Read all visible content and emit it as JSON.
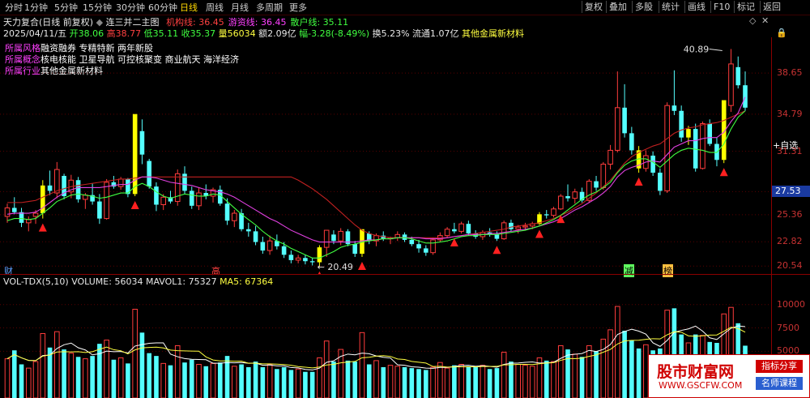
{
  "toolbar": {
    "periods": [
      "分时",
      "1分钟",
      "5分钟",
      "15分钟",
      "30分钟",
      "60分钟",
      "日线",
      "周线",
      "月线",
      "多周期",
      "更多"
    ],
    "active": "日线",
    "buttons": [
      "复权",
      "叠加",
      "多股",
      "统计",
      "画线",
      "F10",
      "标记",
      "返回"
    ],
    "right_side": [
      "+自选",
      "◆ 画"
    ]
  },
  "header": {
    "title": "天力复合(日线 前复权)",
    "indicator": "连三并二主图",
    "lines": [
      {
        "label": "机构线: 36.45",
        "color": "#ff4040"
      },
      {
        "label": "游资线: 36.45",
        "color": "#ff40ff"
      },
      {
        "label": "散户线: 35.11",
        "color": "#40ff40"
      }
    ],
    "date": "2025/04/11/五",
    "open": "开38.06",
    "high": "高38.77",
    "low": "低35.11",
    "close": "收35.37",
    "vol": "量56034",
    "amount": "额2.09亿",
    "change": "幅-3.28(-8.49%)",
    "turnover": "换5.23%",
    "float": "流通1.07亿",
    "sector": "其他金属新材料"
  },
  "tags": [
    {
      "label": "所属风格",
      "text": "融资融券 专精特新 两年新股"
    },
    {
      "label": "所属概念",
      "text": "核电核能 卫星导航 可控核聚变 商业航天 海洋经济"
    },
    {
      "label": "所属行业",
      "text": "其他金属新材料"
    }
  ],
  "price_axis": [
    "38.65",
    "34.79",
    "31.31",
    "27.53",
    "25.36",
    "22.82",
    "20.54"
  ],
  "current_price": "27.53",
  "annotations": {
    "high": "40.89",
    "low": "← 20.49",
    "markers": [
      "财",
      "高",
      "减",
      "榜"
    ]
  },
  "volume_header": {
    "name": "VOL-TDX(5,10)",
    "volume": "VOLUME: 56034",
    "mavol1": "MAVOL1: 75327",
    "ma5": "MA5: 67364"
  },
  "volume_axis": [
    "10000",
    "7500",
    "5000"
  ],
  "watermark": {
    "site": "股市财富网",
    "url": "WWW.GSCFW.COM",
    "b1": "指标分享",
    "b2": "名师课程"
  },
  "chart_data": {
    "type": "candlestick",
    "ylim": [
      19.8,
      42.0
    ],
    "candles": [
      [
        25.2,
        26.4,
        24.6,
        26.0
      ],
      [
        26.0,
        27.0,
        25.4,
        25.6
      ],
      [
        25.6,
        26.0,
        24.2,
        24.6
      ],
      [
        24.6,
        25.2,
        23.8,
        24.9
      ],
      [
        25.2,
        25.8,
        24.5,
        25.5
      ],
      [
        25.5,
        28.6,
        25.0,
        28.1
      ],
      [
        28.1,
        29.5,
        27.2,
        27.6
      ],
      [
        27.4,
        30.3,
        26.9,
        29.6
      ],
      [
        29.0,
        29.2,
        26.8,
        27.1
      ],
      [
        27.5,
        29.1,
        26.9,
        28.6
      ],
      [
        28.6,
        28.9,
        26.5,
        26.8
      ],
      [
        26.8,
        27.4,
        25.9,
        27.2
      ],
      [
        27.2,
        28.3,
        26.3,
        26.6
      ],
      [
        26.6,
        27.3,
        24.5,
        25.0
      ],
      [
        25.0,
        28.7,
        24.9,
        28.4
      ],
      [
        28.4,
        29.0,
        27.8,
        28.0
      ],
      [
        28.0,
        28.9,
        27.7,
        28.7
      ],
      [
        28.7,
        28.8,
        27.0,
        27.3
      ],
      [
        27.3,
        31.5,
        27.1,
        34.8
      ],
      [
        33.2,
        34.3,
        30.1,
        31.0
      ],
      [
        30.4,
        30.6,
        27.8,
        28.0
      ],
      [
        28.0,
        28.4,
        25.7,
        26.3
      ],
      [
        26.3,
        27.3,
        25.8,
        27.0
      ],
      [
        27.0,
        27.6,
        26.4,
        26.6
      ],
      [
        26.6,
        29.6,
        26.2,
        29.2
      ],
      [
        29.2,
        29.9,
        27.3,
        27.6
      ],
      [
        27.6,
        28.0,
        25.9,
        26.2
      ],
      [
        26.2,
        27.9,
        25.8,
        27.4
      ],
      [
        27.4,
        28.2,
        26.8,
        27.1
      ],
      [
        27.1,
        27.9,
        26.5,
        27.7
      ],
      [
        27.7,
        28.1,
        26.2,
        26.4
      ],
      [
        26.4,
        26.9,
        24.4,
        24.8
      ],
      [
        24.8,
        25.8,
        24.2,
        25.5
      ],
      [
        25.5,
        25.9,
        23.8,
        24.0
      ],
      [
        24.0,
        24.6,
        23.3,
        23.8
      ],
      [
        23.8,
        24.3,
        22.5,
        22.8
      ],
      [
        22.8,
        23.3,
        21.7,
        22.0
      ],
      [
        22.0,
        23.4,
        21.6,
        22.9
      ],
      [
        22.9,
        23.5,
        22.1,
        22.4
      ],
      [
        22.4,
        22.8,
        21.3,
        21.6
      ],
      [
        21.6,
        22.0,
        20.8,
        21.1
      ],
      [
        21.1,
        21.6,
        20.8,
        21.3
      ],
      [
        21.3,
        21.6,
        20.7,
        21.0
      ],
      [
        21.0,
        21.3,
        20.6,
        20.9
      ],
      [
        20.9,
        22.5,
        20.5,
        22.3
      ],
      [
        22.3,
        23.2,
        21.4,
        23.9
      ],
      [
        23.5,
        23.9,
        22.6,
        22.9
      ],
      [
        22.9,
        24.1,
        22.5,
        23.8
      ],
      [
        23.8,
        24.0,
        22.4,
        22.6
      ],
      [
        22.6,
        22.9,
        21.4,
        21.7
      ],
      [
        21.7,
        23.6,
        21.4,
        24.0
      ],
      [
        23.6,
        23.8,
        22.6,
        22.9
      ],
      [
        22.9,
        23.6,
        22.4,
        23.4
      ],
      [
        23.4,
        23.8,
        22.9,
        23.1
      ],
      [
        23.1,
        23.3,
        22.6,
        23.2
      ],
      [
        23.2,
        23.8,
        22.9,
        23.5
      ],
      [
        23.5,
        23.7,
        22.8,
        23.0
      ],
      [
        23.0,
        23.3,
        22.4,
        22.6
      ],
      [
        22.6,
        23.0,
        21.8,
        22.2
      ],
      [
        22.2,
        22.5,
        21.5,
        21.8
      ],
      [
        21.8,
        23.2,
        21.6,
        23.0
      ],
      [
        23.0,
        23.7,
        22.8,
        23.4
      ],
      [
        23.4,
        24.2,
        23.2,
        24.0
      ],
      [
        24.0,
        24.6,
        23.6,
        23.8
      ],
      [
        23.8,
        24.7,
        23.6,
        24.5
      ],
      [
        24.5,
        24.8,
        23.4,
        23.6
      ],
      [
        23.6,
        23.9,
        23.1,
        23.3
      ],
      [
        23.3,
        23.9,
        23.0,
        23.7
      ],
      [
        23.7,
        24.1,
        23.3,
        23.5
      ],
      [
        23.5,
        23.8,
        22.9,
        23.1
      ],
      [
        23.1,
        24.8,
        23.0,
        24.6
      ],
      [
        24.6,
        24.9,
        23.8,
        24.0
      ],
      [
        24.0,
        24.4,
        23.6,
        24.2
      ],
      [
        24.2,
        24.6,
        23.9,
        24.3
      ],
      [
        24.3,
        24.7,
        24.0,
        24.5
      ],
      [
        24.5,
        25.6,
        24.4,
        25.4
      ],
      [
        25.4,
        25.8,
        25.0,
        25.3
      ],
      [
        25.3,
        26.1,
        25.1,
        25.9
      ],
      [
        25.9,
        27.3,
        25.8,
        27.1
      ],
      [
        27.1,
        28.2,
        26.6,
        26.9
      ],
      [
        26.9,
        27.8,
        26.4,
        27.5
      ],
      [
        27.5,
        27.9,
        26.5,
        26.7
      ],
      [
        26.7,
        28.7,
        26.5,
        28.5
      ],
      [
        28.5,
        29.0,
        27.6,
        27.9
      ],
      [
        27.9,
        30.3,
        27.7,
        30.1
      ],
      [
        30.1,
        31.9,
        29.6,
        31.4
      ],
      [
        31.4,
        38.8,
        31.2,
        35.4
      ],
      [
        35.4,
        37.6,
        32.6,
        33.0
      ],
      [
        33.0,
        33.6,
        31.0,
        31.4
      ],
      [
        31.4,
        31.8,
        29.3,
        29.7
      ],
      [
        29.7,
        31.4,
        29.4,
        30.9
      ],
      [
        30.9,
        31.3,
        29.0,
        29.3
      ],
      [
        29.3,
        29.7,
        27.2,
        27.6
      ],
      [
        27.6,
        35.9,
        27.4,
        35.6
      ],
      [
        35.6,
        38.9,
        34.7,
        35.1
      ],
      [
        35.1,
        35.6,
        32.2,
        32.6
      ],
      [
        32.6,
        33.7,
        31.9,
        33.4
      ],
      [
        33.4,
        33.9,
        29.4,
        29.7
      ],
      [
        29.7,
        34.1,
        29.6,
        33.9
      ],
      [
        33.9,
        34.3,
        31.8,
        32.0
      ],
      [
        32.0,
        32.6,
        29.9,
        30.5
      ],
      [
        30.5,
        34.9,
        30.2,
        36.1
      ],
      [
        35.6,
        40.9,
        35.0,
        39.5
      ],
      [
        39.2,
        40.2,
        37.2,
        37.5
      ],
      [
        37.5,
        38.8,
        35.1,
        35.4
      ]
    ],
    "yellow_idx": [
      5,
      18,
      44,
      50,
      75,
      89,
      96,
      101
    ],
    "arrow_idx": [
      5,
      18,
      44,
      50,
      63,
      69,
      75,
      78,
      89,
      101
    ],
    "volumes": [
      4200,
      5100,
      3600,
      3200,
      3900,
      6900,
      5400,
      7100,
      5200,
      4800,
      4400,
      4200,
      4500,
      5800,
      6200,
      4100,
      4300,
      3700,
      9500,
      7000,
      4800,
      4500,
      3700,
      3500,
      5600,
      3800,
      4100,
      3600,
      3400,
      3700,
      3800,
      4500,
      3400,
      3600,
      3300,
      3900,
      3300,
      3600,
      3100,
      3300,
      3000,
      3100,
      2800,
      2800,
      4300,
      6100,
      3900,
      5200,
      4000,
      3900,
      7000,
      3600,
      4000,
      3300,
      3500,
      3400,
      3300,
      3200,
      3100,
      3000,
      3300,
      3800,
      3200,
      3500,
      3600,
      3400,
      3300,
      3500,
      3100,
      3200,
      4900,
      3900,
      3600,
      3500,
      3400,
      4300,
      4000,
      3900,
      5600,
      5200,
      4700,
      4400,
      5600,
      5000,
      6300,
      7300,
      9800,
      7200,
      6200,
      5300,
      5700,
      5100,
      5300,
      9400,
      9600,
      6800,
      5900,
      6800,
      6700,
      6000,
      5900,
      9000,
      9700,
      8000,
      5600
    ],
    "ma_inst": [
      26.5,
      26.5,
      26.5,
      26.6,
      26.7,
      27.0,
      27.3,
      27.6,
      27.8,
      28.0,
      28.1,
      28.2,
      28.3,
      28.4,
      28.5,
      28.6,
      28.7,
      28.7,
      28.8,
      28.9,
      28.9,
      28.9,
      28.9,
      28.9,
      28.9,
      28.9,
      28.9,
      28.9,
      28.9,
      28.9,
      28.9,
      28.9,
      28.9,
      28.9,
      28.9,
      28.9,
      28.9,
      28.9,
      28.9,
      28.9,
      28.9,
      28.6,
      28.2,
      27.8,
      27.3,
      26.8,
      26.2,
      25.6,
      25.0,
      24.4,
      23.9,
      23.6,
      23.4,
      23.3,
      23.2,
      23.2,
      23.2,
      23.2,
      23.2,
      23.2,
      23.2,
      23.2,
      23.2,
      23.3,
      23.4,
      23.5,
      23.6,
      23.7,
      23.8,
      23.9,
      24.0,
      24.2,
      24.3,
      24.4,
      24.5,
      24.6,
      24.8,
      25.0,
      25.3,
      25.6,
      26.0,
      26.4,
      26.9,
      27.4,
      28.0,
      28.6,
      29.4,
      30.2,
      30.8,
      31.2,
      31.5,
      31.8,
      32.0,
      32.5,
      33.0,
      33.3,
      33.5,
      33.6,
      33.8,
      33.9,
      34.0,
      34.2,
      34.5,
      34.8,
      35.1
    ],
    "ma_hot": [
      25.4,
      25.5,
      25.5,
      25.5,
      25.6,
      26.0,
      26.5,
      27.0,
      27.4,
      27.7,
      27.9,
      27.9,
      27.9,
      27.9,
      28.0,
      28.1,
      28.2,
      28.2,
      28.6,
      28.9,
      28.9,
      28.8,
      28.6,
      28.4,
      28.3,
      28.2,
      28.1,
      27.9,
      27.7,
      27.6,
      27.5,
      27.3,
      27.0,
      26.6,
      26.2,
      25.8,
      25.4,
      25.0,
      24.7,
      24.3,
      23.9,
      23.6,
      23.3,
      23.0,
      22.8,
      22.8,
      22.8,
      22.8,
      22.8,
      22.8,
      22.9,
      23.0,
      23.0,
      23.1,
      23.1,
      23.2,
      23.2,
      23.2,
      23.2,
      23.1,
      23.1,
      23.1,
      23.2,
      23.3,
      23.4,
      23.5,
      23.5,
      23.5,
      23.6,
      23.6,
      23.7,
      23.8,
      23.9,
      24.0,
      24.1,
      24.3,
      24.5,
      24.7,
      25.0,
      25.4,
      25.8,
      26.1,
      26.5,
      26.9,
      27.4,
      28.0,
      28.9,
      29.5,
      29.8,
      30.0,
      30.3,
      30.4,
      30.3,
      31.0,
      31.7,
      32.0,
      32.3,
      32.3,
      32.5,
      32.6,
      32.6,
      33.1,
      34.1,
      34.9,
      36.4
    ],
    "ma_retail": [
      24.8,
      25.0,
      25.0,
      24.9,
      25.0,
      25.5,
      26.0,
      26.6,
      26.9,
      27.2,
      27.3,
      27.2,
      27.1,
      26.9,
      27.0,
      27.2,
      27.4,
      27.4,
      28.0,
      28.3,
      28.0,
      27.5,
      27.1,
      26.9,
      27.1,
      27.3,
      27.2,
      27.1,
      27.1,
      27.3,
      27.2,
      26.6,
      26.0,
      25.4,
      24.9,
      24.4,
      23.8,
      23.3,
      22.9,
      22.6,
      22.2,
      21.9,
      21.6,
      21.3,
      21.3,
      21.6,
      21.9,
      22.3,
      22.5,
      22.6,
      22.8,
      22.9,
      23.0,
      23.1,
      23.1,
      23.2,
      23.2,
      23.1,
      22.9,
      22.7,
      22.7,
      22.8,
      22.9,
      23.1,
      23.3,
      23.4,
      23.4,
      23.5,
      23.5,
      23.5,
      23.6,
      23.7,
      23.8,
      23.9,
      24.1,
      24.3,
      24.6,
      24.9,
      25.3,
      25.8,
      26.3,
      26.8,
      27.2,
      27.5,
      27.9,
      28.4,
      29.3,
      30.0,
      30.4,
      30.6,
      30.6,
      30.3,
      29.8,
      30.4,
      31.0,
      31.4,
      31.6,
      31.5,
      31.4,
      31.2,
      31.2,
      32.0,
      33.4,
      34.5,
      35.1
    ]
  }
}
